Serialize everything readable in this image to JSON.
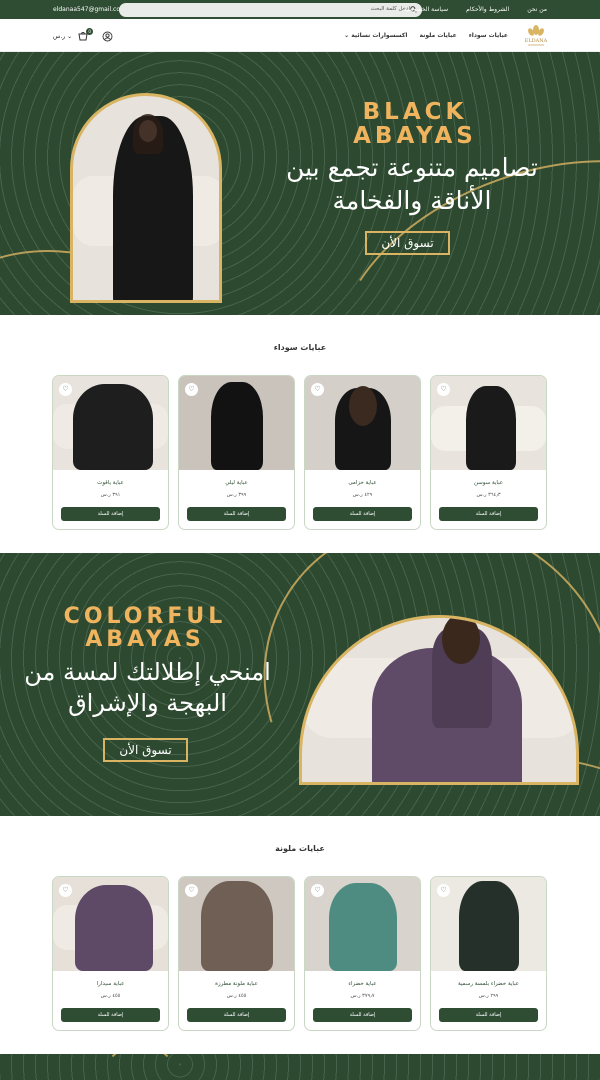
{
  "topbar": {
    "email": "eldanaa547@gmail.com",
    "search_placeholder": "ادخل كلمة البحث",
    "links": [
      "من نحن",
      "الشروط والأحكام",
      "سياسة الخصوصية"
    ]
  },
  "navbar": {
    "logo_text": "ELDANA",
    "links": [
      "عبايات سوداء",
      "عبايات ملونة",
      "اكسسوارات نسائية"
    ],
    "currency": "ر.س",
    "cart_count": "0"
  },
  "hero1": {
    "en_line1": "BLACK",
    "en_line2": "ABAYAS",
    "ar_line1": "تصاميم متنوعة تجمع بين",
    "ar_line2": "الأناقة والفخامة",
    "button": "تسوق الأن"
  },
  "section1": {
    "title": "عبايات سوداء",
    "products": [
      {
        "name": "عباية سوسن",
        "price": "٣٦٤٫٣ ر.س"
      },
      {
        "name": "عباية خزامى",
        "price": "٤٢٩ ر.س"
      },
      {
        "name": "عباية ليلي",
        "price": "٣٩٩ ر.س"
      },
      {
        "name": "عباية ياقوت",
        "price": "٣٩١ ر.س"
      }
    ],
    "add_label": "إضافة للسلة"
  },
  "hero2": {
    "en_line1": "COLORFUL",
    "en_line2": "ABAYAS",
    "ar_line1": "امنحي إطلالتك لمسة من",
    "ar_line2": "البهجة والإشراق",
    "button": "تسوق الأن"
  },
  "section2": {
    "title": "عبايات ملونة",
    "products": [
      {
        "name": "عباية خضراء بلمسة رسمية",
        "price": "٢٩٩ ر.س"
      },
      {
        "name": "عباية خضراء",
        "price": "٣٧٩٫٧ ر.س"
      },
      {
        "name": "عباية ملونة مطرزة",
        "price": "٤٥٥ ر.س"
      },
      {
        "name": "عباية سيدارا",
        "price": "٤٥٥ ر.س"
      }
    ],
    "add_label": "إضافة للسلة"
  },
  "colors": {
    "brand_green": "#2e4d33",
    "gold": "#d9b463",
    "title_gold": "#f0b45e"
  }
}
